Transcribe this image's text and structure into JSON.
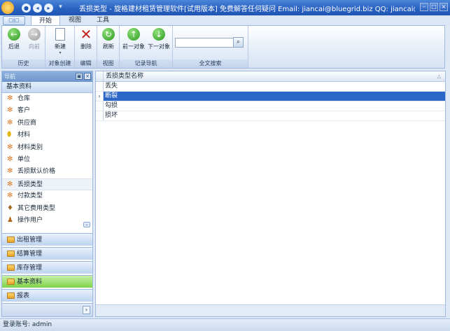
{
  "window": {
    "title": "丢损类型 - 旋格建材租赁管理软件[试用版本] 免费解答任何疑问 Email: jiancai@bluegrid.biz QQ: jiancai@blue..."
  },
  "ribbon": {
    "app_button_label": "▢|▢",
    "tabs": [
      "开始",
      "视图",
      "工具"
    ],
    "groups": {
      "history": {
        "label": "历史",
        "back": "后退",
        "forward": "向前"
      },
      "create": {
        "label": "对象创建",
        "new": "新建"
      },
      "edit": {
        "label": "编辑",
        "delete": "删除"
      },
      "view": {
        "label": "视图",
        "refresh": "刷新"
      },
      "record_nav": {
        "label": "记录导航",
        "prev": "前一对象",
        "next": "下一对象"
      },
      "search": {
        "label": "全文搜索",
        "value": ""
      }
    }
  },
  "nav": {
    "header": "导航",
    "section": "基本资料",
    "items": [
      "仓库",
      "客户",
      "供应商",
      "材料",
      "材料类别",
      "单位",
      "丢损默认价格",
      "丢损类型",
      "付款类型",
      "其它费用类型",
      "操作用户"
    ],
    "selected": "丢损类型",
    "panes": [
      "出租管理",
      "结算管理",
      "库存管理",
      "基本资料",
      "报表"
    ],
    "active_pane": "基本资料"
  },
  "grid": {
    "column": "丢损类型名称",
    "rows": [
      "丢失",
      "断裂",
      "勾损",
      "损坏"
    ],
    "selected_index": 1
  },
  "status": {
    "login": "登录账号: admin"
  },
  "colors": {
    "accent": "#2c66c6",
    "active_pane": "#7fd24b"
  }
}
